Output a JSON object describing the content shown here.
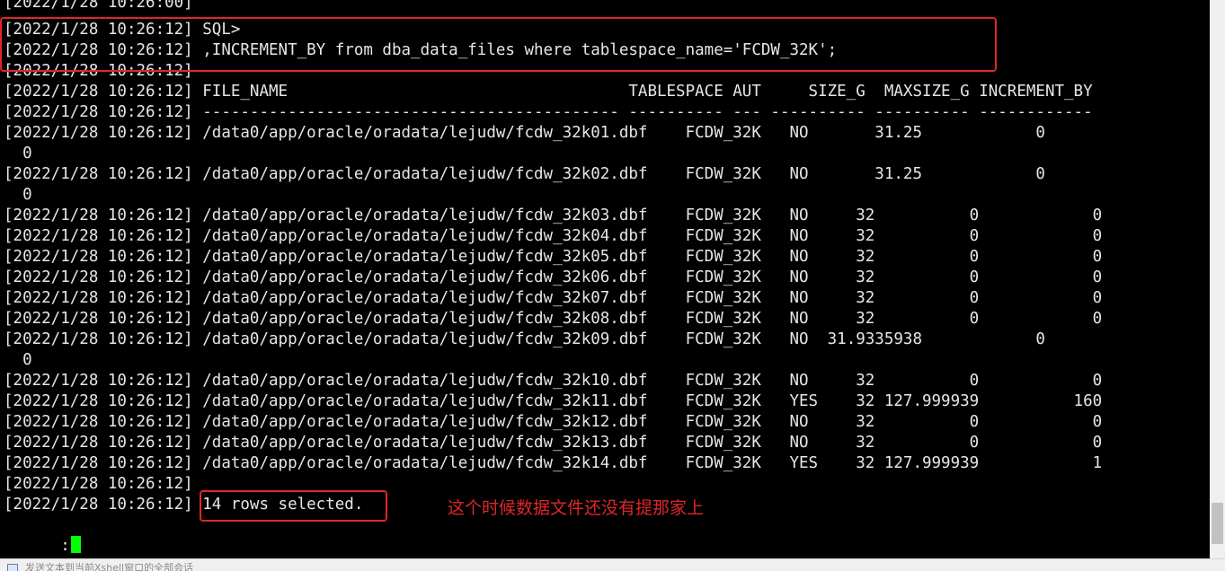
{
  "terminal": {
    "lines": [
      "[2022/1/28 10:26:00]",
      "[2022/1/28 10:26:12] SQL>",
      "[2022/1/28 10:26:12] ,INCREMENT_BY from dba_data_files where tablespace_name='FCDW_32K';",
      "[2022/1/28 10:26:12]",
      "[2022/1/28 10:26:12] FILE_NAME                                    TABLESPACE AUT     SIZE_G  MAXSIZE_G INCREMENT_BY",
      "[2022/1/28 10:26:12] -------------------------------------------- ---------- --- ---------- ---------- ------------",
      "[2022/1/28 10:26:12] /data0/app/oracle/oradata/lejudw/fcdw_32k01.dbf    FCDW_32K   NO       31.25            0",
      "  0",
      "[2022/1/28 10:26:12] /data0/app/oracle/oradata/lejudw/fcdw_32k02.dbf    FCDW_32K   NO       31.25            0",
      "  0",
      "[2022/1/28 10:26:12] /data0/app/oracle/oradata/lejudw/fcdw_32k03.dbf    FCDW_32K   NO     32          0            0",
      "[2022/1/28 10:26:12] /data0/app/oracle/oradata/lejudw/fcdw_32k04.dbf    FCDW_32K   NO     32          0            0",
      "[2022/1/28 10:26:12] /data0/app/oracle/oradata/lejudw/fcdw_32k05.dbf    FCDW_32K   NO     32          0            0",
      "[2022/1/28 10:26:12] /data0/app/oracle/oradata/lejudw/fcdw_32k06.dbf    FCDW_32K   NO     32          0            0",
      "[2022/1/28 10:26:12] /data0/app/oracle/oradata/lejudw/fcdw_32k07.dbf    FCDW_32K   NO     32          0            0",
      "[2022/1/28 10:26:12] /data0/app/oracle/oradata/lejudw/fcdw_32k08.dbf    FCDW_32K   NO     32          0            0",
      "[2022/1/28 10:26:12] /data0/app/oracle/oradata/lejudw/fcdw_32k09.dbf    FCDW_32K   NO  31.9335938            0",
      "  0",
      "[2022/1/28 10:26:12] /data0/app/oracle/oradata/lejudw/fcdw_32k10.dbf    FCDW_32K   NO     32          0            0",
      "[2022/1/28 10:26:12] /data0/app/oracle/oradata/lejudw/fcdw_32k11.dbf    FCDW_32K   YES    32 127.999939          160",
      "[2022/1/28 10:26:12] /data0/app/oracle/oradata/lejudw/fcdw_32k12.dbf    FCDW_32K   NO     32          0            0",
      "[2022/1/28 10:26:12] /data0/app/oracle/oradata/lejudw/fcdw_32k13.dbf    FCDW_32K   NO     32          0            0",
      "[2022/1/28 10:26:12] /data0/app/oracle/oradata/lejudw/fcdw_32k14.dbf    FCDW_32K   YES    32 127.999939            1",
      "[2022/1/28 10:26:12]",
      "[2022/1/28 10:26:12] 14 rows selected."
    ],
    "prompt": ":"
  },
  "annotation": {
    "text": "这个时候数据文件还没有提那家上"
  },
  "statusbar": {
    "text": "发送文本到当前Xshell窗口的全部会话"
  },
  "colors": {
    "background": "#000000",
    "text": "#e6e6e6",
    "highlight": "#e0262a",
    "annotation": "#e0262a",
    "cursor": "#00ff00"
  }
}
